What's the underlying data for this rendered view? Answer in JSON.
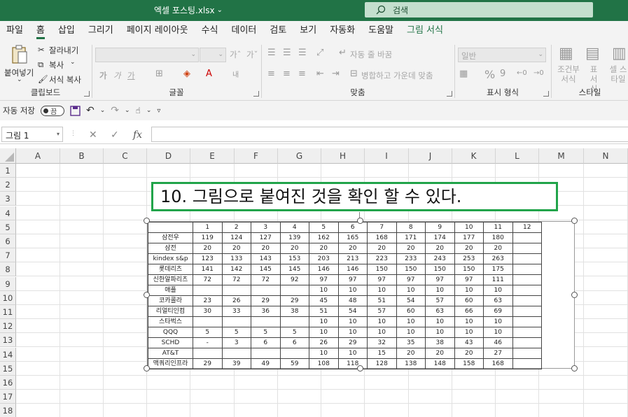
{
  "title_bar": {
    "doc_title": "엑셀 포스팅.xlsx",
    "search_label": "검색"
  },
  "menu": [
    "파일",
    "홈",
    "삽입",
    "그리기",
    "페이지 레이아웃",
    "수식",
    "데이터",
    "검토",
    "보기",
    "자동화",
    "도움말",
    "그림 서식"
  ],
  "ribbon": {
    "clipboard": {
      "paste": "붙여넣기",
      "cut": "잘라내기",
      "copy": "복사",
      "format_painter": "서식 복사",
      "label": "클립보드"
    },
    "font": {
      "label": "글꼴",
      "grow": "가ˆ",
      "shrink": "가ˇ",
      "bold": "가",
      "italic": "가",
      "underline": "가"
    },
    "align": {
      "wrap": "자동 줄 바꿈",
      "merge": "병합하고 가운데 맞춤",
      "label": "맞춤"
    },
    "number": {
      "format": "일반",
      "label": "표시 형식",
      "percent": "%",
      "comma": "9"
    },
    "style": {
      "cond": "조건부 서식",
      "table": "표 서식",
      "cell": "셀 스타일",
      "label": "스타일"
    }
  },
  "qat": {
    "autosave": "자동 저장",
    "toggle": "끔"
  },
  "formula_bar": {
    "name_box": "그림 1",
    "fx": "fx"
  },
  "columns": [
    "A",
    "B",
    "C",
    "D",
    "E",
    "F",
    "G",
    "H",
    "I",
    "J",
    "K",
    "L",
    "M",
    "N"
  ],
  "rows": [
    "1",
    "2",
    "3",
    "4",
    "5",
    "6",
    "7",
    "8",
    "9",
    "10",
    "11",
    "12",
    "13",
    "14",
    "15",
    "16",
    "17",
    "18"
  ],
  "textbox": "10. 그림으로 붙여진 것을 확인 할 수 있다.",
  "picture_table": {
    "header": [
      "",
      "1",
      "2",
      "3",
      "4",
      "5",
      "6",
      "7",
      "8",
      "9",
      "10",
      "11",
      "12"
    ],
    "rows": [
      [
        "삼전우",
        "119",
        "124",
        "127",
        "139",
        "162",
        "165",
        "168",
        "171",
        "174",
        "177",
        "180",
        ""
      ],
      [
        "삼전",
        "20",
        "20",
        "20",
        "20",
        "20",
        "20",
        "20",
        "20",
        "20",
        "20",
        "20",
        ""
      ],
      [
        "kindex s&p",
        "123",
        "133",
        "143",
        "153",
        "203",
        "213",
        "223",
        "233",
        "243",
        "253",
        "263",
        ""
      ],
      [
        "롯데리츠",
        "141",
        "142",
        "145",
        "145",
        "146",
        "146",
        "150",
        "150",
        "150",
        "150",
        "175",
        ""
      ],
      [
        "신한알파리츠",
        "72",
        "72",
        "72",
        "92",
        "97",
        "97",
        "97",
        "97",
        "97",
        "97",
        "111",
        ""
      ],
      [
        "애플",
        "",
        "",
        "",
        "",
        "10",
        "10",
        "10",
        "10",
        "10",
        "10",
        "10",
        ""
      ],
      [
        "코카콜라",
        "23",
        "26",
        "29",
        "29",
        "45",
        "48",
        "51",
        "54",
        "57",
        "60",
        "63",
        ""
      ],
      [
        "리얼티인컴",
        "30",
        "33",
        "36",
        "38",
        "51",
        "54",
        "57",
        "60",
        "63",
        "66",
        "69",
        ""
      ],
      [
        "스타벅스",
        "",
        "",
        "",
        "",
        "10",
        "10",
        "10",
        "10",
        "10",
        "10",
        "10",
        ""
      ],
      [
        "QQQ",
        "5",
        "5",
        "5",
        "5",
        "10",
        "10",
        "10",
        "10",
        "10",
        "10",
        "10",
        ""
      ],
      [
        "SCHD",
        "-",
        "3",
        "6",
        "6",
        "26",
        "29",
        "32",
        "35",
        "38",
        "43",
        "46",
        ""
      ],
      [
        "AT&T",
        "",
        "",
        "",
        "",
        "10",
        "10",
        "15",
        "20",
        "20",
        "20",
        "27",
        ""
      ],
      [
        "맥쿼리인프라",
        "29",
        "39",
        "49",
        "59",
        "108",
        "118",
        "128",
        "138",
        "148",
        "158",
        "168",
        ""
      ]
    ]
  }
}
